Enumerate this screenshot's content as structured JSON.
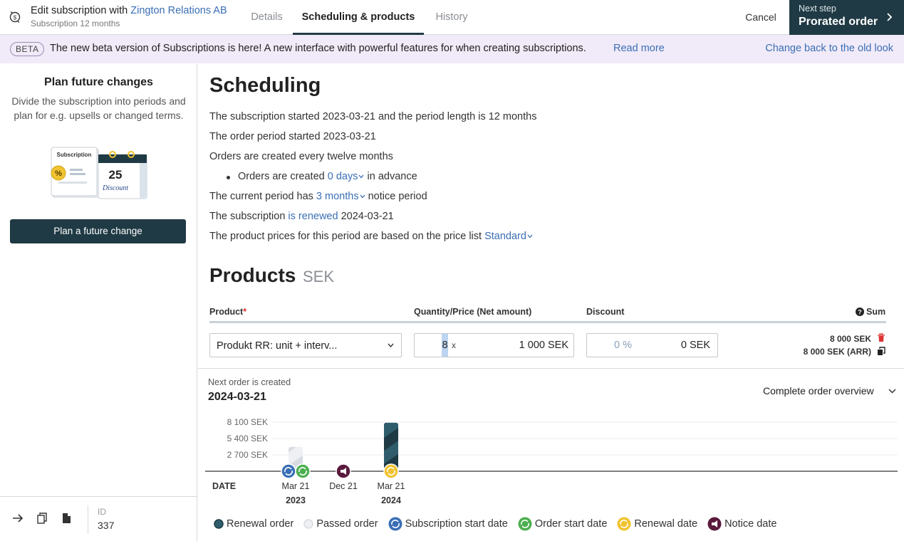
{
  "header": {
    "title_prefix": "Edit subscription with",
    "customer_name": "Zington Relations AB",
    "subtitle": "Subscription 12 months",
    "tabs": [
      {
        "label": "Details"
      },
      {
        "label": "Scheduling & products"
      },
      {
        "label": "History"
      }
    ],
    "cancel_label": "Cancel",
    "next_step_small": "Next step",
    "next_step_label": "Prorated order"
  },
  "beta_bar": {
    "badge": "BETA",
    "message": "The new beta version of Subscriptions is here! A new interface with powerful features for when creating subscriptions.",
    "read_more": "Read more",
    "change_back": "Change back to the old look"
  },
  "sidebar": {
    "title": "Plan future changes",
    "description": "Divide the subscription into periods and plan for e.g. upsells or changed terms.",
    "illustration": {
      "label": "Subscription",
      "percent": "%",
      "day": "25",
      "caption": "Discount"
    },
    "plan_button": "Plan a future change",
    "id_label": "ID",
    "id_value": "337"
  },
  "scheduling": {
    "title": "Scheduling",
    "line1": "The subscription started 2023-03-21 and the period length is 12 months",
    "line2": "The order period started 2023-03-21",
    "line3": "Orders are created every twelve months",
    "line4_prefix": "Orders are created",
    "line4_link": "0 days",
    "line4_suffix": "in advance",
    "line5_prefix": "The current period has",
    "line5_link": "3 months",
    "line5_suffix": "notice period",
    "line6_prefix": "The subscription",
    "line6_link": "is renewed",
    "line6_suffix": "2024-03-21",
    "line7_prefix": "The product prices for this period are based on the price list",
    "line7_link": "Standard"
  },
  "products": {
    "title": "Products",
    "currency": "SEK",
    "col_product": "Product",
    "col_required": "*",
    "col_qty_price": "Quantity/Price (Net amount)",
    "col_discount": "Discount",
    "col_sum": "Sum",
    "row": {
      "product": "Produkt RR: unit + interv...",
      "quantity": "8",
      "times": "x",
      "price": "1 000 SEK",
      "discount_percent": "0 %",
      "discount_amount": "0 SEK",
      "sum": "8 000 SEK",
      "sum_arr": "8 000 SEK (ARR)"
    }
  },
  "order_panel": {
    "label": "Next order is created",
    "date": "2024-03-21",
    "overview": "Complete order overview",
    "date_axis_label": "DATE"
  },
  "chart_data": {
    "type": "bar",
    "y_tick_labels": [
      "8 100 SEK",
      "5 400 SEK",
      "2 700 SEK"
    ],
    "y_ticks": [
      8100,
      5400,
      2700
    ],
    "ylim": [
      0,
      8100
    ],
    "bars": [
      {
        "date": "Mar 21 2023",
        "value": 4000,
        "kind": "Passed order"
      },
      {
        "date": "Mar 21 2024",
        "value": 8000,
        "kind": "Renewal order"
      }
    ],
    "markers": [
      {
        "date": "Mar 21 2023",
        "kind": "Subscription start date"
      },
      {
        "date": "Mar 21 2023",
        "kind": "Order start date"
      },
      {
        "date": "Dec 21 2023",
        "kind": "Notice date"
      },
      {
        "date": "Mar 21 2024",
        "kind": "Renewal date"
      }
    ],
    "x_labels": [
      {
        "label": "Mar 21",
        "year": "2023"
      },
      {
        "label": "Dec 21",
        "year": ""
      },
      {
        "label": "Mar 21",
        "year": "2024"
      }
    ],
    "legend": [
      "Renewal order",
      "Passed order",
      "Subscription start date",
      "Order start date",
      "Renewal date",
      "Notice date"
    ],
    "colors": {
      "renewal_order": "#1f3a44",
      "passed_order": "#d8dce2",
      "subscription_start": "#3a6fb5",
      "order_start": "#4caf50",
      "renewal_date": "#f0c330",
      "notice_date": "#5a1a3c"
    }
  }
}
